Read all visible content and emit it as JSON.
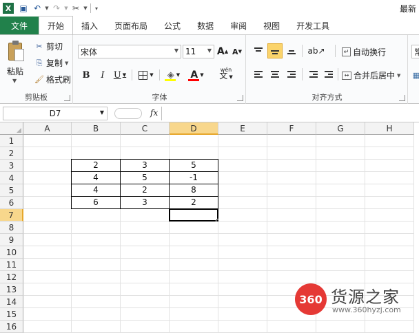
{
  "window": {
    "title": "最新"
  },
  "tabs": [
    "文件",
    "开始",
    "插入",
    "页面布局",
    "公式",
    "数据",
    "审阅",
    "视图",
    "开发工具"
  ],
  "active_tab": "开始",
  "clipboard": {
    "paste": "粘贴",
    "cut": "剪切",
    "copy": "复制",
    "format_painter": "格式刷",
    "label": "剪贴板"
  },
  "font": {
    "name": "宋体",
    "size": "11",
    "grow": "A",
    "shrink": "A",
    "bold": "B",
    "italic": "I",
    "underline": "U",
    "phonetic": "wén",
    "label": "字体",
    "fill_color": "#ffff00",
    "font_color": "#ff0000"
  },
  "alignment": {
    "wrap_text": "自动换行",
    "merge_center": "合并后居中",
    "label": "对齐方式",
    "number_format_partial": "常"
  },
  "formula_bar": {
    "name_box": "D7",
    "fx": "fx",
    "value": ""
  },
  "grid": {
    "columns": [
      "A",
      "B",
      "C",
      "D",
      "E",
      "F",
      "G",
      "H"
    ],
    "rows": [
      "1",
      "2",
      "3",
      "4",
      "5",
      "6",
      "7",
      "8",
      "9",
      "10",
      "11",
      "12",
      "13",
      "14",
      "15",
      "16"
    ],
    "active_cell": "D7",
    "data": {
      "B3": "2",
      "C3": "3",
      "D3": "5",
      "B4": "4",
      "C4": "5",
      "D4": "-1",
      "B5": "4",
      "C5": "2",
      "D5": "8",
      "B6": "6",
      "C6": "3",
      "D6": "2"
    }
  },
  "watermark": {
    "logo": "360",
    "name": "货源之家",
    "url": "www.360hyzj.com"
  },
  "colors": {
    "file_tab": "#21814b",
    "selection_header": "#f8d78c",
    "watermark_red": "#e53935"
  }
}
